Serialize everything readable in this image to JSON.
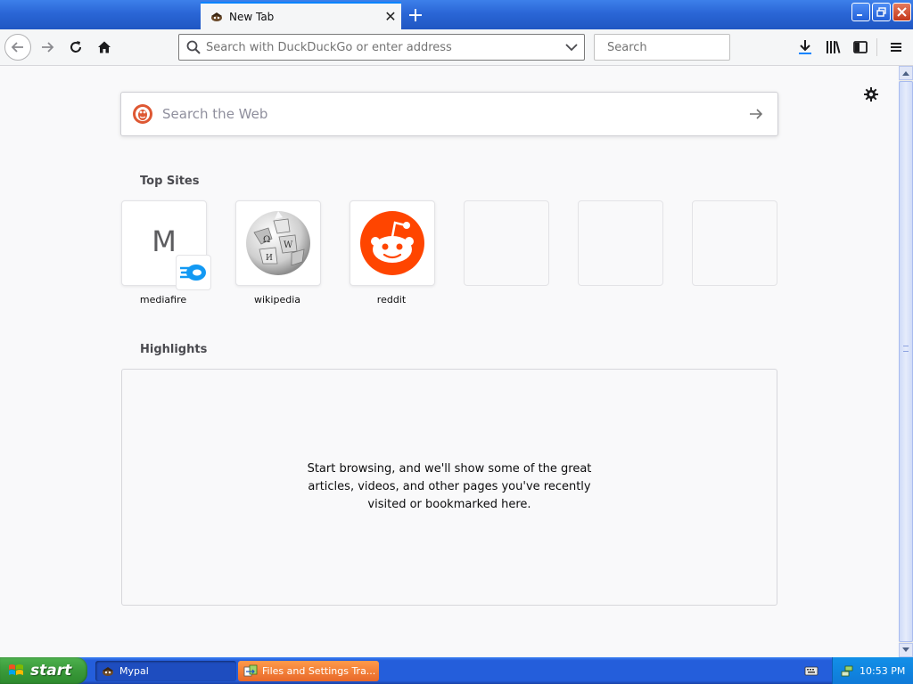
{
  "tab": {
    "title": "New Tab"
  },
  "navbar": {
    "url_placeholder": "Search with DuckDuckGo or enter address",
    "search_placeholder": "Search"
  },
  "newtab": {
    "websearch_placeholder": "Search the Web",
    "topsites_title": "Top Sites",
    "top_sites": [
      {
        "label": "mediafire",
        "letter": "M"
      },
      {
        "label": "wikipedia"
      },
      {
        "label": "reddit"
      }
    ],
    "highlights_title": "Highlights",
    "highlights_message": "Start browsing, and we'll show some of the great articles, videos, and other pages you've recently visited or bookmarked here."
  },
  "taskbar": {
    "start_label": "start",
    "tasks": [
      {
        "label": "Mypal"
      },
      {
        "label": "Files and Settings Tra..."
      }
    ],
    "clock": "10:53 PM"
  },
  "colors": {
    "accent": "#0a84ff",
    "reddit": "#ff4500",
    "duckduckgo": "#de5833",
    "mediafire": "#1299f3",
    "xp_blue": "#245edb",
    "xp_start_green": "#3a9a3a"
  },
  "icons": [
    "back-icon",
    "forward-icon",
    "reload-icon",
    "home-icon",
    "search-icon",
    "dropdown-icon",
    "download-icon",
    "library-icon",
    "sidebar-icon",
    "menu-icon",
    "gear-icon",
    "arrow-right-icon",
    "duckduckgo-icon",
    "mediafire-icon",
    "wikipedia-globe-icon",
    "reddit-icon",
    "windows-flag-icon"
  ]
}
